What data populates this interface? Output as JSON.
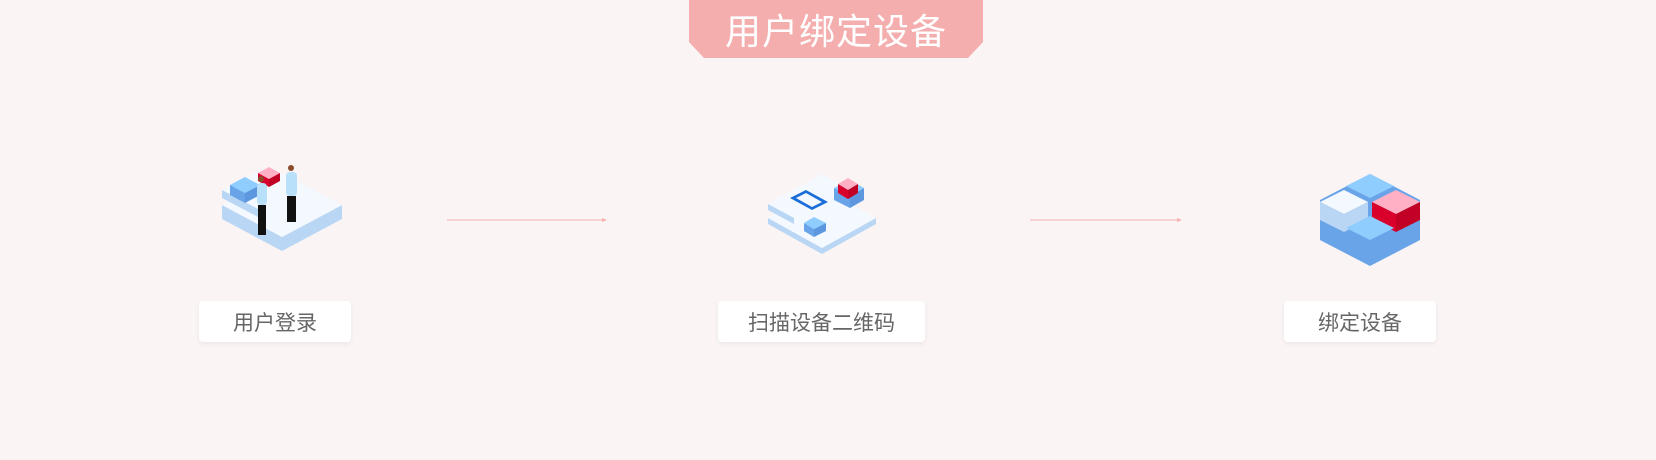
{
  "header": {
    "title": "用户绑定设备"
  },
  "steps": [
    {
      "label": "用户登录",
      "icon": "people-exchange-icon"
    },
    {
      "label": "扫描设备二维码",
      "icon": "scan-qr-icon"
    },
    {
      "label": "绑定设备",
      "icon": "bind-blocks-icon"
    }
  ],
  "colors": {
    "background": "#faf4f4",
    "banner": "#f5aeae",
    "arrow": "#f7c6c6",
    "label_text": "#666666",
    "accent_red": "#d9002c",
    "accent_blue": "#6aa4e8"
  }
}
